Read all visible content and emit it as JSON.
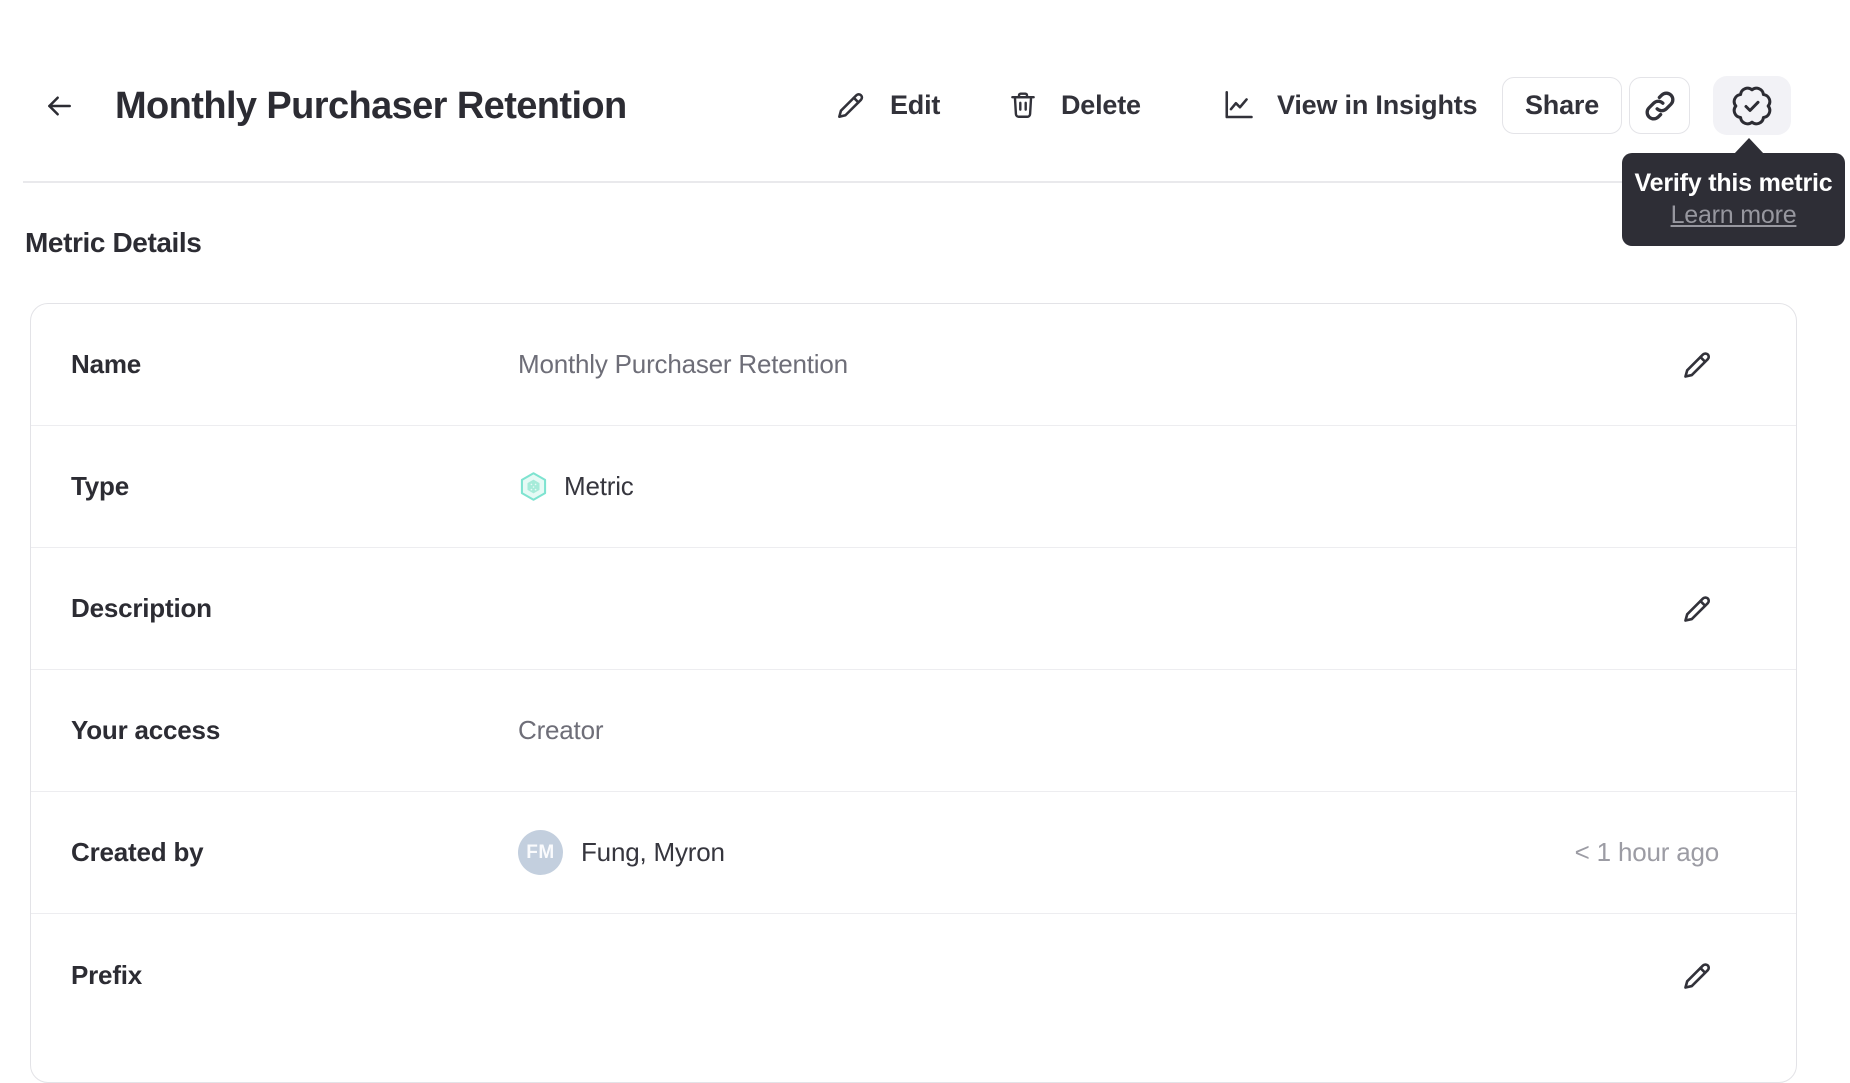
{
  "header": {
    "title": "Monthly Purchaser Retention",
    "actions": {
      "edit_label": "Edit",
      "delete_label": "Delete",
      "insights_label": "View in Insights",
      "share_label": "Share"
    }
  },
  "tooltip": {
    "title": "Verify this metric",
    "link_label": "Learn more"
  },
  "section": {
    "title": "Metric Details"
  },
  "details": {
    "rows": [
      {
        "label": "Name",
        "value": "Monthly Purchaser Retention",
        "editable": true
      },
      {
        "label": "Type",
        "value": "Metric",
        "icon": "metric-hexagon-icon"
      },
      {
        "label": "Description",
        "value": "",
        "editable": true
      },
      {
        "label": "Your access",
        "value": "Creator"
      },
      {
        "label": "Created by",
        "value": "Fung, Myron",
        "avatar_initials": "FM",
        "meta": "< 1 hour ago"
      },
      {
        "label": "Prefix",
        "value": "",
        "editable": true
      }
    ]
  },
  "icons": [
    "back-arrow-icon",
    "pencil-icon",
    "trash-icon",
    "line-chart-icon",
    "link-icon",
    "verified-badge-icon",
    "metric-hexagon-icon"
  ],
  "colors": {
    "text_dark": "#2c2c33",
    "text_gray": "#6e6e78",
    "text_light_gray": "#9c9ca4",
    "border": "#e4e4e8",
    "tooltip_bg": "#2e2e36",
    "tooltip_link": "#97979f",
    "verify_btn_bg": "#f2f2f6",
    "avatar_bg": "#c3cfde",
    "metric_teal_stroke": "#7ee3d0",
    "metric_teal_fill": "#e6faf5",
    "metric_teal_inner": "#a6ebd9"
  }
}
